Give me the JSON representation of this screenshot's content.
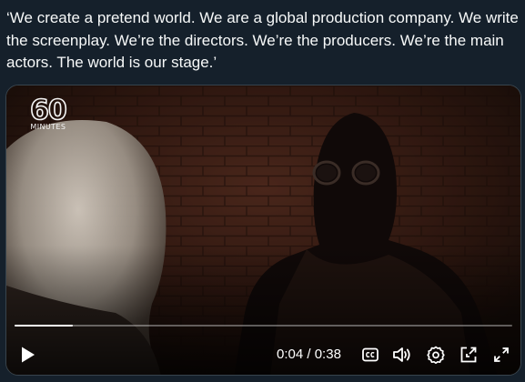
{
  "post": {
    "text": "‘We create a pretend world. We are a global production company. We write the screenplay. We’re the directors. We’re the producers. We’re the main actors. The world is our stage.’"
  },
  "video": {
    "logo_number": "60",
    "logo_word": "MINUTES",
    "current_time": "0:04",
    "separator": "/",
    "duration": "0:38",
    "progress_fraction": 0.117
  },
  "controls": {
    "play_icon": "play-icon",
    "captions_icon": "closed-captions-icon",
    "volume_icon": "volume-icon",
    "settings_icon": "gear-icon",
    "popout_icon": "popout-icon",
    "fullscreen_icon": "fullscreen-icon"
  }
}
